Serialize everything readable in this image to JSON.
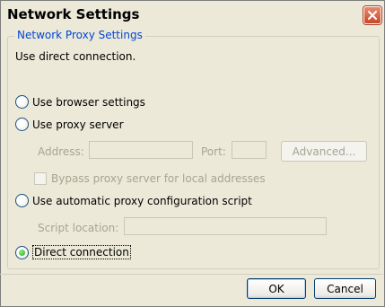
{
  "window": {
    "title": "Network Settings"
  },
  "group": {
    "caption": "Network Proxy Settings",
    "status_text": "Use direct connection."
  },
  "options": {
    "browser": "Use browser settings",
    "proxy": "Use proxy server",
    "auto": "Use automatic proxy configuration script",
    "direct": "Direct connection"
  },
  "proxy_fields": {
    "address_label": "Address:",
    "address_value": "",
    "port_label": "Port:",
    "port_value": "",
    "advanced_label": "Advanced...",
    "bypass_label": "Bypass proxy server for local addresses"
  },
  "script_fields": {
    "location_label": "Script location:",
    "location_value": ""
  },
  "buttons": {
    "ok": "OK",
    "cancel": "Cancel"
  },
  "selected_option": "direct",
  "colors": {
    "background": "#ece9d8",
    "caption": "#0046d5",
    "disabled_text": "#a7a492"
  }
}
